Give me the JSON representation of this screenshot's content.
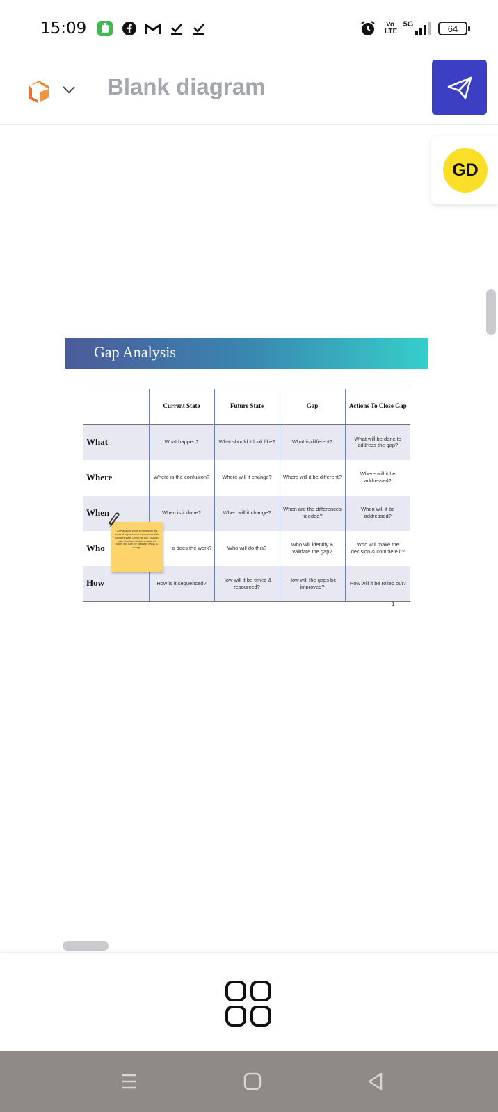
{
  "status_bar": {
    "time": "15:09",
    "icons": [
      "app-notification-icon",
      "facebook-icon",
      "gmail-icon",
      "download-done-icon",
      "download-done-icon",
      "alarm-icon",
      "volte-icon",
      "5g-signal-icon"
    ],
    "volte_label": "Vo LTE",
    "network": "5G",
    "battery": "64"
  },
  "header": {
    "logo": "lucid-logo-icon",
    "menu_icon": "chevron-down-icon",
    "title": "Blank diagram",
    "share_icon": "paper-plane-icon",
    "accent_color": "#3b3fc4"
  },
  "collaborator": {
    "initials": "GD",
    "color": "#f9df28"
  },
  "slide": {
    "title": "Gap Analysis",
    "page_number": "1",
    "columns": [
      "",
      "Current State",
      "Future State",
      "Gap",
      "Actions To Close Gap"
    ],
    "rows": [
      {
        "label": "What",
        "cells": [
          "What happen?",
          "What should it look like?",
          "What is different?",
          "What will be done to address the gap?"
        ]
      },
      {
        "label": "Where",
        "cells": [
          "Where is the confusion?",
          "Where will it change?",
          "Where will it be different?",
          "Where will it be addressed?"
        ]
      },
      {
        "label": "When",
        "cells": [
          "When is it done?",
          "When will it change?",
          "When are the differences needed?",
          "When will it be addressed?"
        ]
      },
      {
        "label": "Who",
        "cells": [
          "o does the work?",
          "Who will do this?",
          "Who will identify & validate the gap?",
          "Who will make the decision & complete it?"
        ]
      },
      {
        "label": "How",
        "cells": [
          "How is it sequenced?",
          "How will it be timed & resourced?",
          "How will the gaps be improved?",
          "How will it be rolled out?"
        ]
      }
    ],
    "sticky_note": "GAP analysis helps in identifying key areas of improvement from current state to future state. Using this tool, you can make important decisions about the future and how the business needs to change."
  },
  "toolbar": {
    "grid_icon": "shapes-grid-icon"
  },
  "nav_bar": {
    "buttons": [
      "recent-apps-icon",
      "home-icon",
      "back-icon"
    ]
  }
}
